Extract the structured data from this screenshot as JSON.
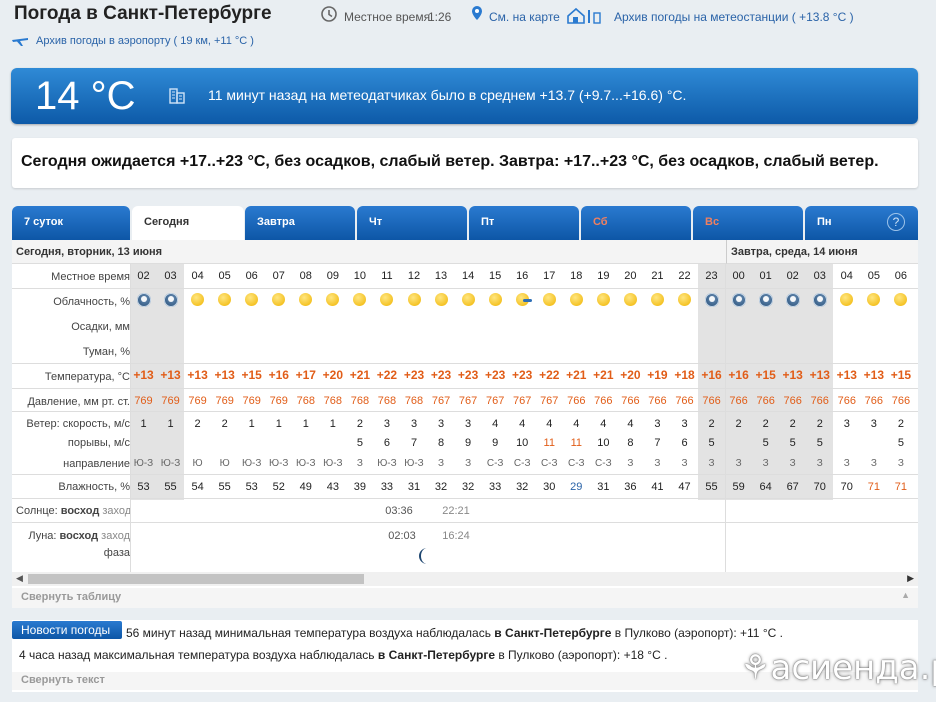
{
  "header": {
    "title": "Погода в Санкт-Петербурге",
    "local_time_label": "Местное время",
    "local_time": "1:26",
    "map_link": "См. на карте",
    "station_archive": "Архив погоды на метеостанции ( +13.8 °C )",
    "airport_archive": "Архив погоды в аэропорту ( 19 км, +11 °C )"
  },
  "current": {
    "temp": "14 °C",
    "note": "11 минут назад на метеодатчиках было в среднем +13.7 (+9.7...+16.6) °C."
  },
  "forecast_text": "Сегодня ожидается +17..+23 °C, без осадков, слабый ветер. Завтра: +17..+23 °C, без осадков, слабый ветер.",
  "tabs": [
    "7 суток",
    "Сегодня",
    "Завтра",
    "Чт",
    "Пт",
    "Сб",
    "Вс",
    "Пн"
  ],
  "help": "?",
  "day_headers": [
    "Сегодня, вторник, 13 июня",
    "Завтра, среда, 14 июня"
  ],
  "labels": {
    "time": "Местное время",
    "cloud": "Облачность, %",
    "precip": "Осадки, мм",
    "fog": "Туман, %",
    "temp": "Температура, °C",
    "pressure": "Давление, мм рт. ст.",
    "wind_speed": "Ветер: скорость, м/с",
    "gusts": "порывы, м/с",
    "direction": "направление",
    "humidity": "Влажность, %",
    "sun": "Солнце:",
    "moon": "Луна:",
    "rise": "восход",
    "set": "заход",
    "phase": "фаза"
  },
  "hours": [
    "02",
    "03",
    "04",
    "05",
    "06",
    "07",
    "08",
    "09",
    "10",
    "11",
    "12",
    "13",
    "14",
    "15",
    "16",
    "17",
    "18",
    "19",
    "20",
    "21",
    "22",
    "23",
    "00",
    "01",
    "02",
    "03",
    "04",
    "05",
    "06"
  ],
  "cloud_icons": [
    "moon",
    "moon",
    "sun",
    "sun",
    "sun",
    "sun",
    "sun",
    "sun",
    "sun",
    "sun",
    "sun",
    "sun",
    "sun",
    "sun",
    "partly",
    "sun",
    "sun",
    "sun",
    "sun",
    "sun",
    "sun",
    "moon",
    "moon",
    "moon",
    "moon",
    "moon",
    "sun",
    "sun",
    "sun"
  ],
  "temps": [
    "+13",
    "+13",
    "+13",
    "+13",
    "+15",
    "+16",
    "+17",
    "+20",
    "+21",
    "+22",
    "+23",
    "+23",
    "+23",
    "+23",
    "+23",
    "+22",
    "+21",
    "+21",
    "+20",
    "+19",
    "+18",
    "+16",
    "+16",
    "+15",
    "+13",
    "+13",
    "+13",
    "+13",
    "+15"
  ],
  "pressure": [
    "769",
    "769",
    "769",
    "769",
    "769",
    "769",
    "768",
    "768",
    "768",
    "768",
    "768",
    "767",
    "767",
    "767",
    "767",
    "767",
    "766",
    "766",
    "766",
    "766",
    "766",
    "766",
    "766",
    "766",
    "766",
    "766",
    "766",
    "766",
    "766"
  ],
  "wind": [
    "1",
    "1",
    "2",
    "2",
    "1",
    "1",
    "1",
    "1",
    "2",
    "3",
    "3",
    "3",
    "3",
    "4",
    "4",
    "4",
    "4",
    "4",
    "4",
    "3",
    "3",
    "2",
    "2",
    "2",
    "2",
    "2",
    "3",
    "3",
    "2"
  ],
  "gusts": [
    "",
    "",
    "",
    "",
    "",
    "",
    "",
    "",
    "5",
    "6",
    "7",
    "8",
    "9",
    "9",
    "10",
    "11",
    "11",
    "10",
    "8",
    "7",
    "6",
    "5",
    "",
    "5",
    "5",
    "5",
    "",
    "",
    "5"
  ],
  "direction": [
    "Ю-З",
    "Ю-З",
    "Ю",
    "Ю",
    "Ю-З",
    "Ю-З",
    "Ю-З",
    "Ю-З",
    "З",
    "Ю-З",
    "Ю-З",
    "З",
    "З",
    "С-З",
    "С-З",
    "С-З",
    "С-З",
    "С-З",
    "З",
    "З",
    "З",
    "З",
    "З",
    "З",
    "З",
    "З",
    "З",
    "З",
    "З"
  ],
  "humidity": [
    "53",
    "55",
    "54",
    "55",
    "53",
    "52",
    "49",
    "43",
    "39",
    "33",
    "31",
    "32",
    "32",
    "33",
    "32",
    "30",
    "29",
    "31",
    "36",
    "41",
    "47",
    "55",
    "59",
    "64",
    "67",
    "70",
    "70",
    "71",
    "71"
  ],
  "sun": {
    "rise": "03:36",
    "set": "22:21"
  },
  "moon": {
    "rise": "02:03",
    "set": "16:24",
    "phase": "moon-phase-icon"
  },
  "collapse_table": "Свернуть таблицу",
  "news": {
    "button": "Новости погоды",
    "line1": {
      "pre": "56 минут назад минимальная температура воздуха наблюдалась ",
      "city": "в Санкт-Петербурге",
      "post": " в Пулково (аэропорт): +11 °C ."
    },
    "line2": {
      "pre": "4 часа назад максимальная температура воздуха наблюдалась ",
      "city": "в Санкт-Петербурге",
      "post": " в Пулково (аэропорт): +18 °C ."
    }
  },
  "collapse_text": "Свернуть текст",
  "watermark": "асиенда.ру",
  "colors": {
    "accent": "#0d5aa8",
    "temp": "#e15d18",
    "link": "#2a63a8"
  }
}
